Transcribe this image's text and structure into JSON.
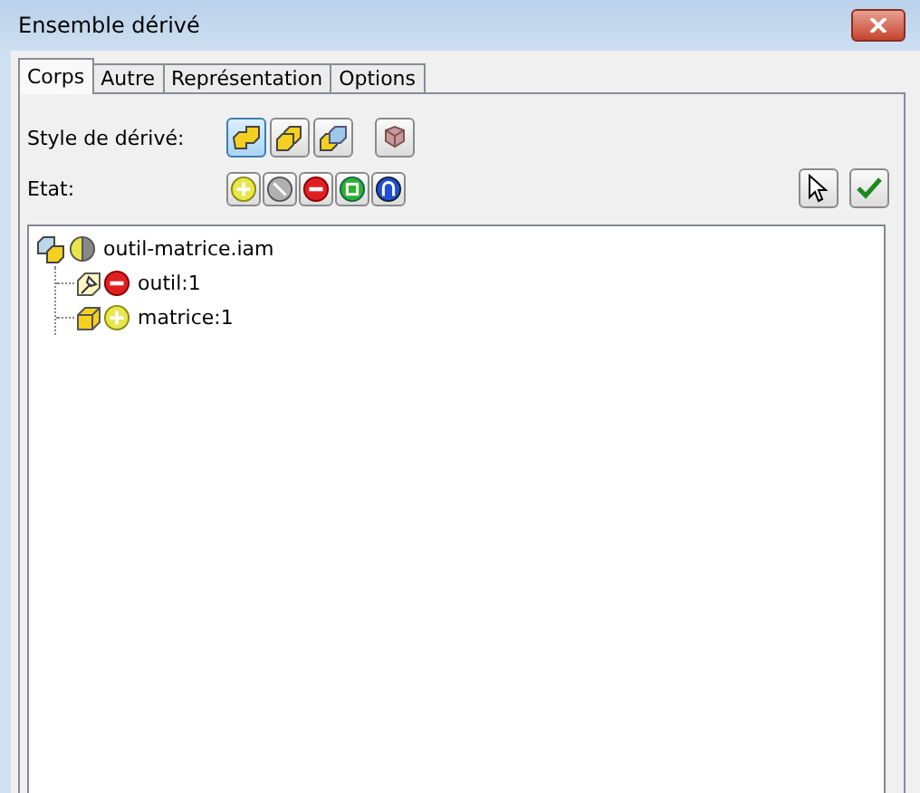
{
  "window": {
    "title": "Ensemble dérivé"
  },
  "tabs": [
    {
      "label": "Corps",
      "selected": true
    },
    {
      "label": "Autre",
      "selected": false
    },
    {
      "label": "Représentation",
      "selected": false
    },
    {
      "label": "Options",
      "selected": false
    }
  ],
  "derive_style": {
    "label": "Style de dérivé:",
    "options": [
      {
        "kind": "single",
        "selected": true
      },
      {
        "kind": "merge",
        "selected": false
      },
      {
        "kind": "surface",
        "selected": false
      },
      {
        "kind": "parts",
        "selected": false
      }
    ]
  },
  "state": {
    "label": "Etat:",
    "options": [
      {
        "kind": "include"
      },
      {
        "kind": "exclude"
      },
      {
        "kind": "subtract"
      },
      {
        "kind": "envelope"
      },
      {
        "kind": "intersect"
      }
    ]
  },
  "tree": {
    "label": "outil-matrice.iam",
    "kind": "assembly",
    "state": {
      "kind": "mixed"
    },
    "children": [
      {
        "label": "outil:1",
        "kind": "tool",
        "state": {
          "kind": "subtract"
        }
      },
      {
        "label": "matrice:1",
        "kind": "part",
        "state": {
          "kind": "include"
        }
      }
    ]
  }
}
